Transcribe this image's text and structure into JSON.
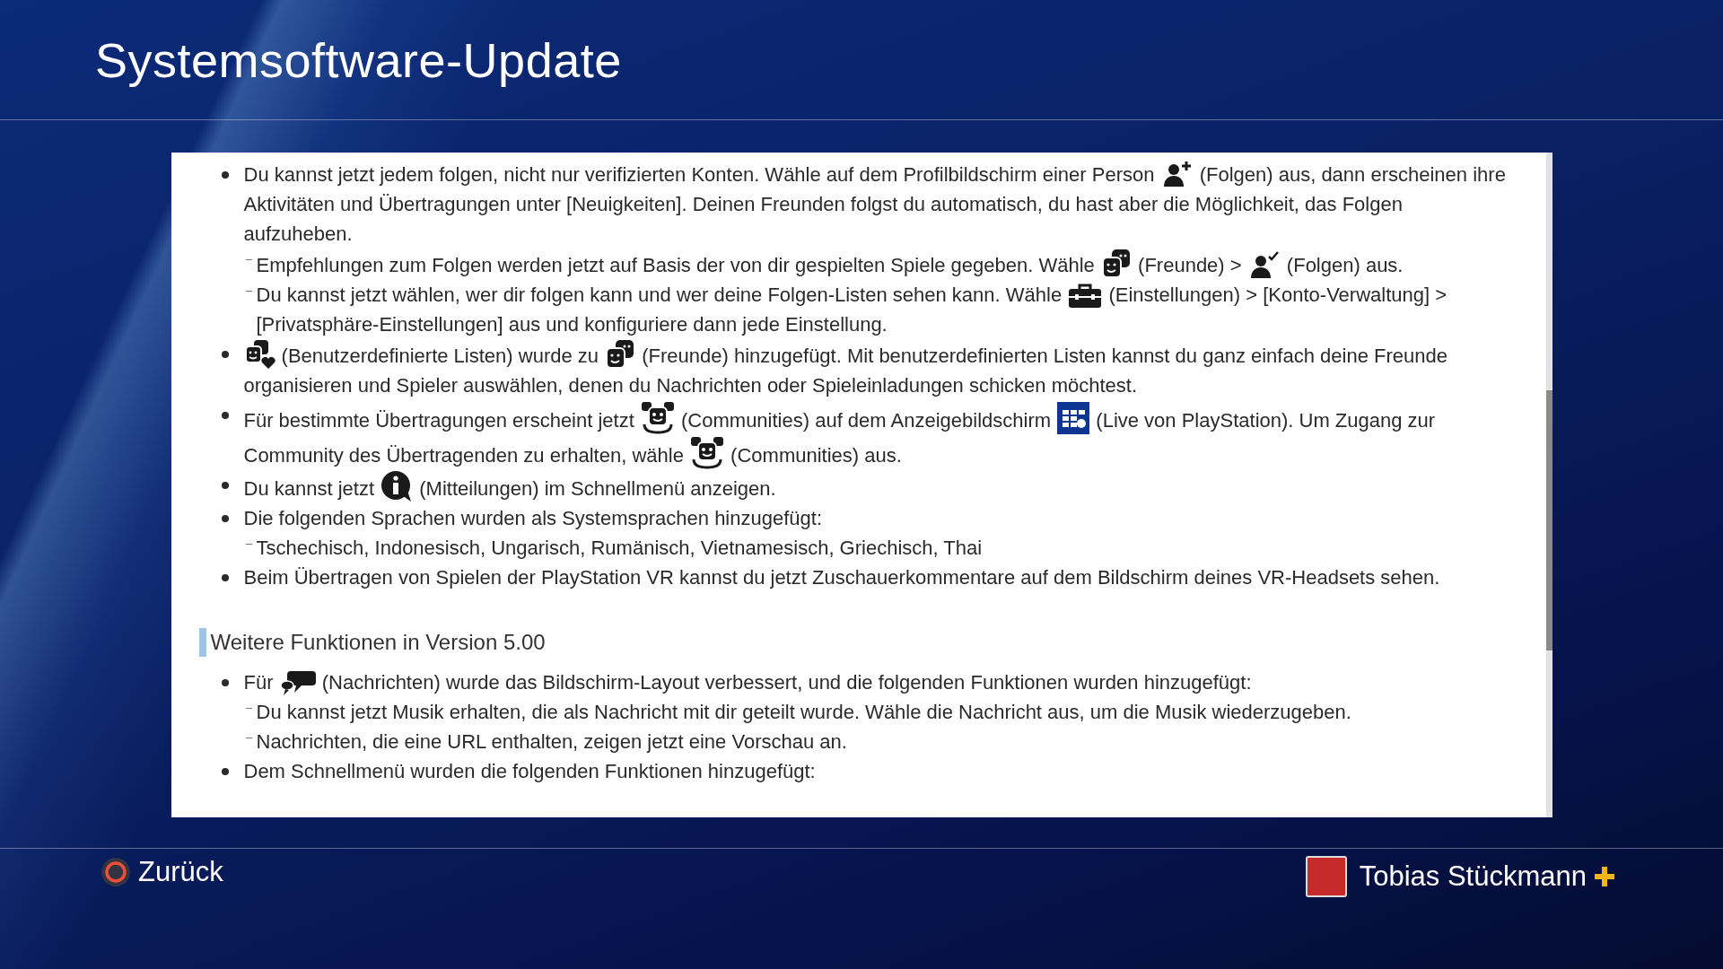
{
  "screen_title": "Systemsoftware-Update",
  "notes": [
    {
      "parts": [
        "Du kannst jetzt jedem folgen, nicht nur verifizierten Konten. Wähle auf dem Profilbildschirm einer Person ",
        {
          "kind": "follow"
        },
        " (Folgen) aus, dann erscheinen ihre Aktivitäten und Übertragungen unter [Neuigkeiten]. Deinen Freunden folgst du automatisch, du hast aber die Möglichkeit, das Folgen aufzuheben."
      ],
      "children": [
        {
          "parts": [
            "Empfehlungen zum Folgen werden jetzt auf Basis der von dir gespielten Spiele gegeben. Wähle ",
            {
              "kind": "friends"
            },
            " (Freunde) > ",
            {
              "kind": "followed"
            },
            " (Folgen) aus."
          ]
        },
        {
          "parts": [
            "Du kannst jetzt wählen, wer dir folgen kann und wer deine Folgen-Listen sehen kann. Wähle ",
            {
              "kind": "settings"
            },
            " (Einstellungen) > [Konto-Verwaltung] > [Privatsphäre-Einstellungen] aus und konfiguriere dann jede Einstellung."
          ]
        }
      ]
    },
    {
      "parts": [
        {
          "kind": "lists"
        },
        " (Benutzerdefinierte Listen) wurde zu ",
        {
          "kind": "friends"
        },
        " (Freunde) hinzugefügt. Mit benutzerdefinierten Listen kannst du ganz einfach deine Freunde organisieren und Spieler auswählen, denen du Nachrichten oder Spieleinladungen schicken möchtest."
      ]
    },
    {
      "parts": [
        "Für bestimmte Übertragungen erscheint jetzt ",
        {
          "kind": "communities"
        },
        " (Communities) auf dem Anzeigebildschirm ",
        {
          "kind": "live"
        },
        " (Live von PlayStation). Um Zugang zur Community des Übertragenden zu erhalten, wähle ",
        {
          "kind": "communities"
        },
        " (Communities) aus."
      ]
    },
    {
      "parts": [
        "Du kannst jetzt ",
        {
          "kind": "info"
        },
        " (Mitteilungen) im Schnellmenü anzeigen."
      ]
    },
    {
      "parts": [
        "Die folgenden Sprachen wurden als Systemsprachen hinzugefügt:"
      ],
      "children": [
        {
          "parts": [
            "Tschechisch, Indonesisch, Ungarisch, Rumänisch, Vietnamesisch, Griechisch, Thai"
          ]
        }
      ]
    },
    {
      "parts": [
        "Beim Übertragen von Spielen der PlayStation VR kannst du jetzt Zuschauerkommentare auf dem Bildschirm deines VR-Headsets sehen."
      ]
    }
  ],
  "section": {
    "heading": "Weitere Funktionen in Version 5.00",
    "items": [
      {
        "parts": [
          "Für ",
          {
            "kind": "messages"
          },
          " (Nachrichten) wurde das Bildschirm-Layout verbessert, und die folgenden Funktionen wurden hinzugefügt:"
        ],
        "children": [
          {
            "parts": [
              "Du kannst jetzt Musik erhalten, die als Nachricht mit dir geteilt wurde. Wähle die Nachricht aus, um die Musik wiederzugeben."
            ]
          },
          {
            "parts": [
              "Nachrichten, die eine URL enthalten, zeigen jetzt eine Vorschau an."
            ]
          }
        ]
      },
      {
        "parts": [
          "Dem Schnellmenü wurden die folgenden Funktionen hinzugefügt:"
        ]
      }
    ]
  },
  "footer": {
    "back_label": "Zurück",
    "user_name": "Tobias Stückmann"
  }
}
